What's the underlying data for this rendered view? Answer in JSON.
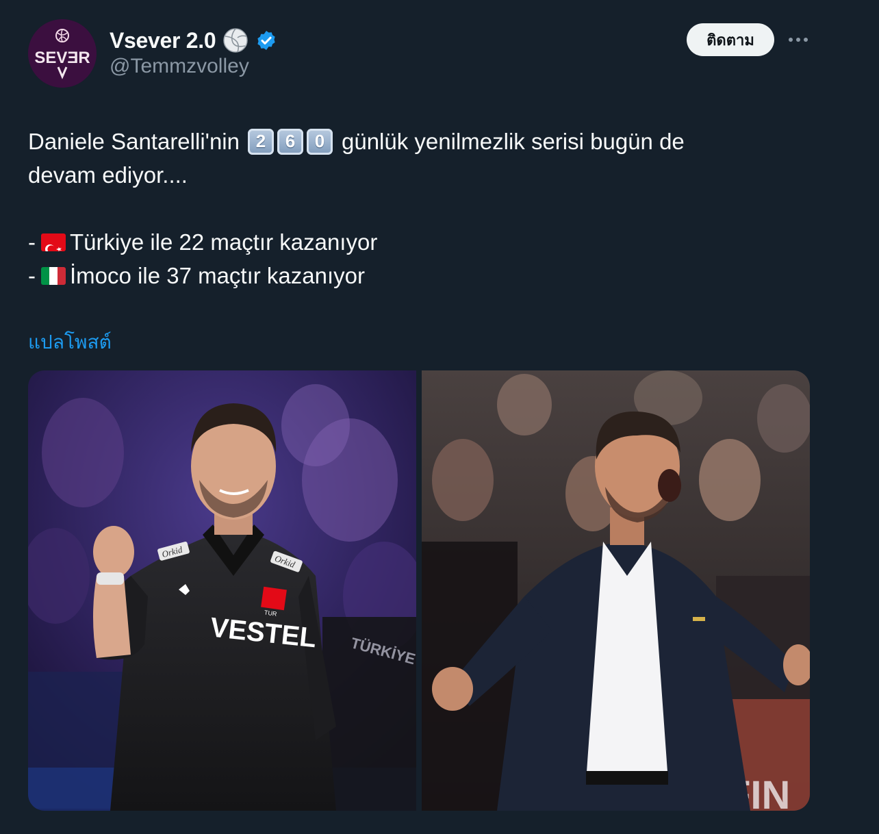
{
  "author": {
    "display_name": "Vsever 2.0",
    "handle": "@Temmzvolley",
    "avatar_text": "SEVƎR",
    "name_emoji": "volleyball-emoji",
    "verified_badge": "verified-badge-icon"
  },
  "actions": {
    "follow_label": "ติดตาม",
    "more_icon": "more-options-icon"
  },
  "tweet": {
    "line1_prefix": "Daniele Santarelli'nin",
    "keycaps": [
      "2",
      "6",
      "0"
    ],
    "line1_suffix": "günlük yenilmezlik serisi bugün de",
    "line2": "devam ediyor....",
    "bullet_dash": "-",
    "bullet1_text": "Türkiye ile 22 maçtır kazanıyor",
    "bullet2_text": "İmoco ile 37 maçtır kazanıyor",
    "translate_label": "แปลโพสต์"
  },
  "media": {
    "photo1": {
      "jersey_text": "VESTEL",
      "sponsor_text": "Orkid",
      "badge_text": "TUR",
      "sleeve_text": "TÜRKİYE"
    },
    "photo2": {
      "board_text": "FIN"
    }
  },
  "colors": {
    "background": "#15202b",
    "text": "#f7f9f9",
    "secondary": "#8b98a5",
    "link": "#1d9bf0",
    "verified": "#1d9bf0"
  }
}
